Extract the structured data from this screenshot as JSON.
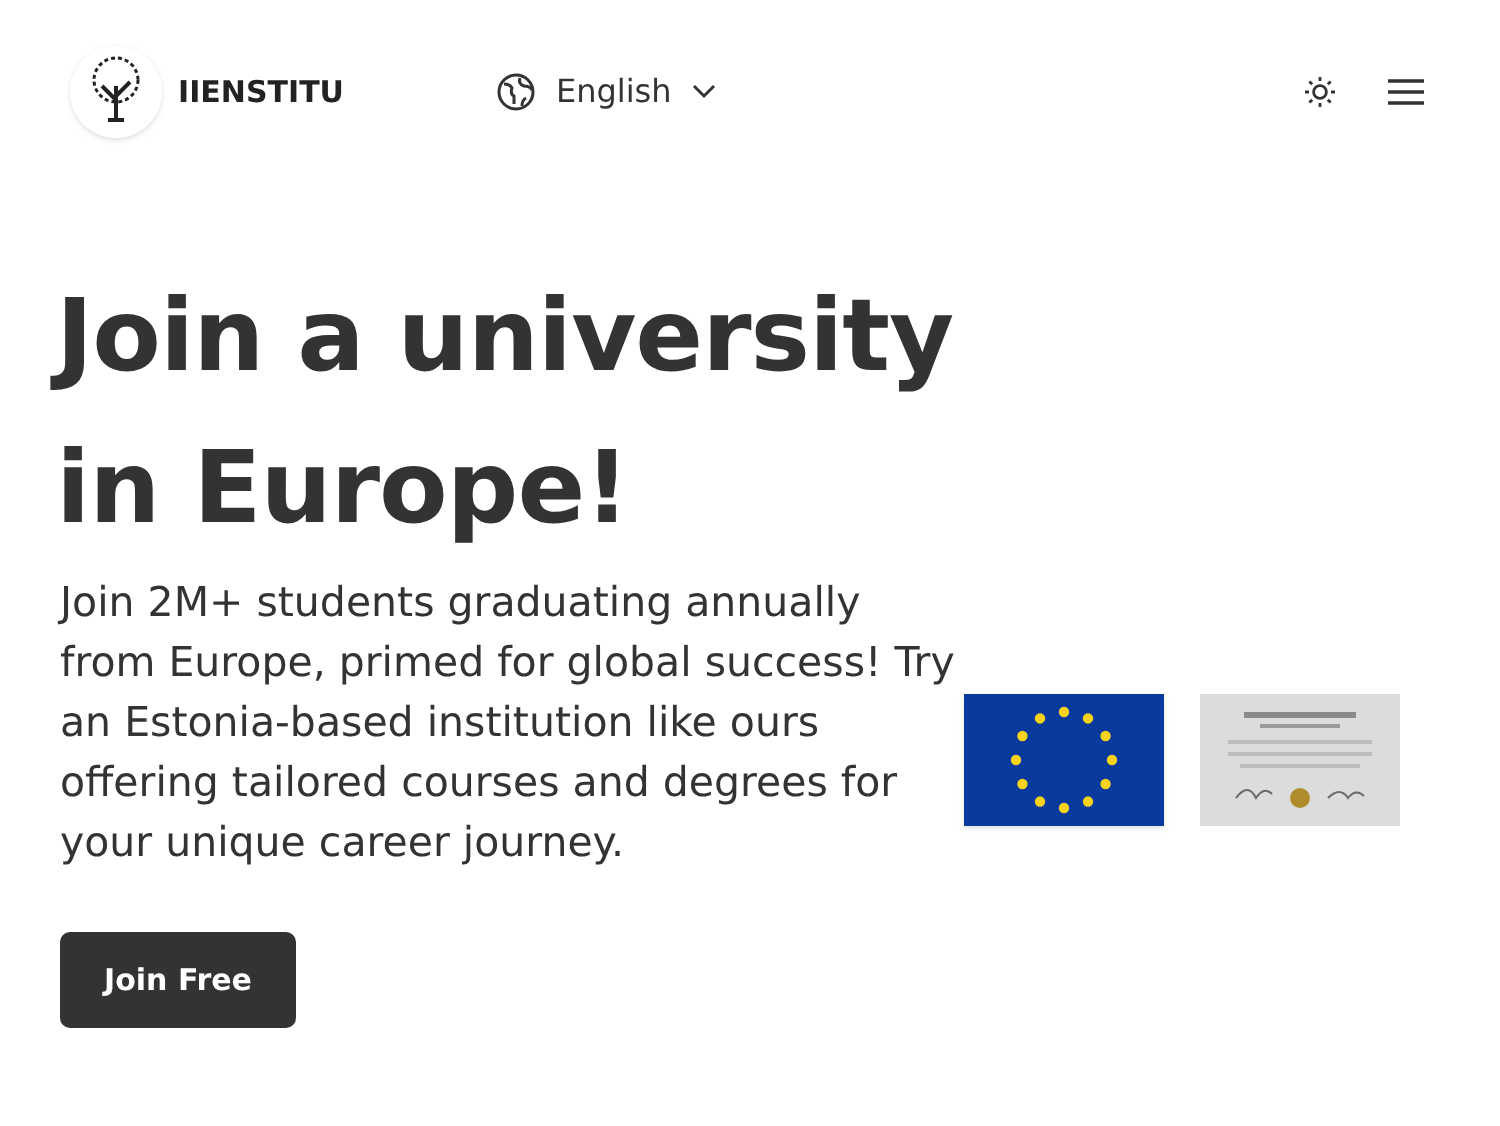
{
  "header": {
    "brand": "IIENSTITU",
    "language": "English"
  },
  "hero": {
    "title_lines": [
      "Join a university",
      "in Europe!"
    ],
    "body": "Join 2M+ students graduating annually from Europe, primed for global success! Try an Estonia-based institution like ours offering tailored courses and degrees for your unique career journey.",
    "cta": "Join Free"
  }
}
